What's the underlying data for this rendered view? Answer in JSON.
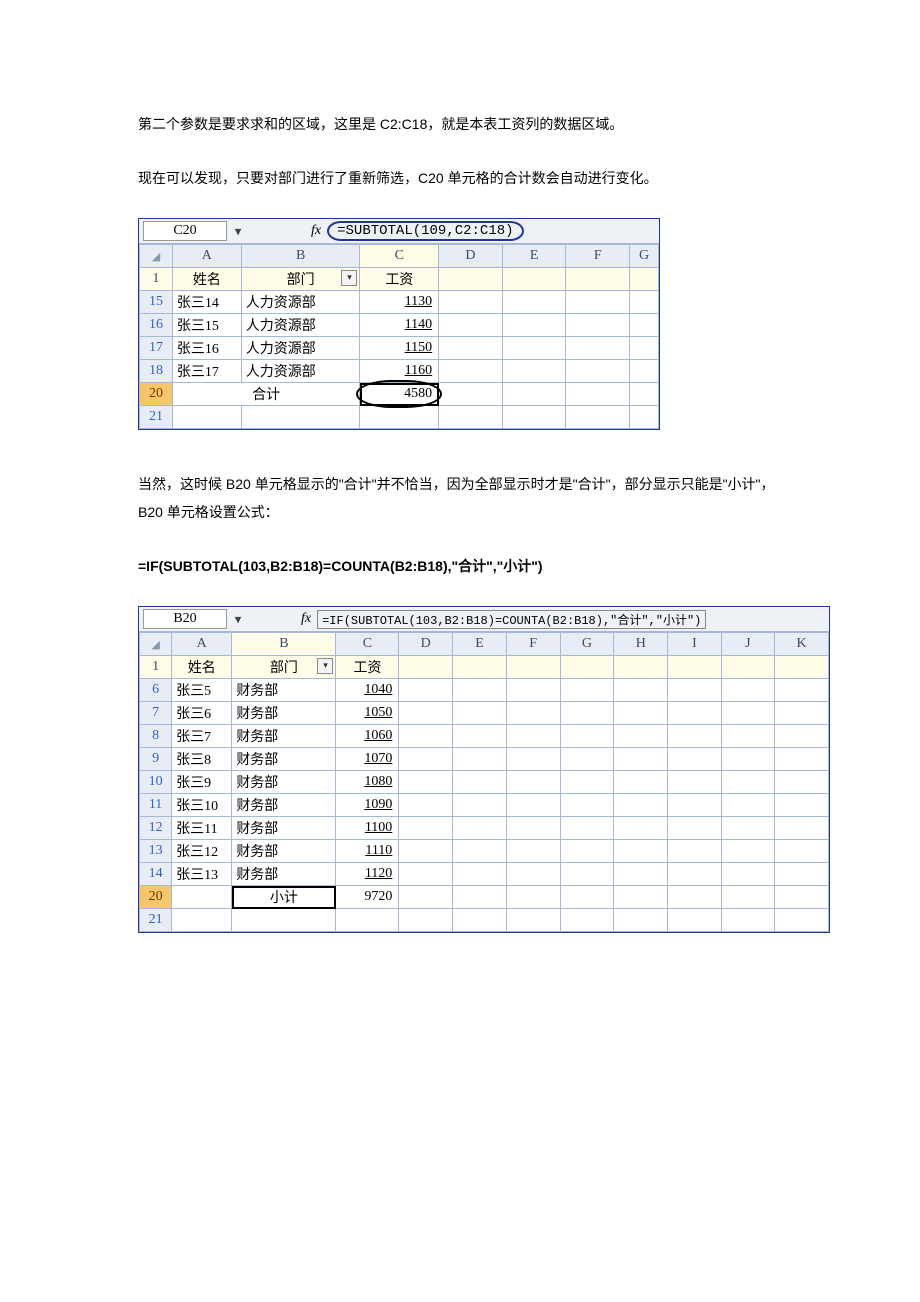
{
  "text": {
    "p1": "第二个参数是要求求和的区域，这里是 C2:C18，就是本表工资列的数据区域。",
    "p2": "现在可以发现，只要对部门进行了重新筛选，C20 单元格的合计数会自动进行变化。",
    "p3": "当然，这时候 B20 单元格显示的\"合计\"并不恰当，因为全部显示时才是\"合计\"，部分显示只能是\"小计\"，B20 单元格设置公式：",
    "formula_inline": "=IF(SUBTOTAL(103,B2:B18)=COUNTA(B2:B18),\"合计\",\"小计\")"
  },
  "sheet1": {
    "active_cell": "C20",
    "formula": "=SUBTOTAL(109,C2:C18)",
    "fx_label": "fx",
    "cols": [
      "A",
      "B",
      "C",
      "D",
      "E",
      "F",
      "G"
    ],
    "header": {
      "A": "姓名",
      "B": "部门",
      "C": "工资"
    },
    "rows": [
      {
        "n": "15",
        "a": "张三14",
        "b": "人力资源部",
        "c": "1130"
      },
      {
        "n": "16",
        "a": "张三15",
        "b": "人力资源部",
        "c": "1140"
      },
      {
        "n": "17",
        "a": "张三16",
        "b": "人力资源部",
        "c": "1150"
      },
      {
        "n": "18",
        "a": "张三17",
        "b": "人力资源部",
        "c": "1160"
      }
    ],
    "total": {
      "n": "20",
      "label": "合计",
      "value": "4580"
    },
    "blank_row": "21",
    "filter_glyph": "▾"
  },
  "sheet2": {
    "active_cell": "B20",
    "formula": "=IF(SUBTOTAL(103,B2:B18)=COUNTA(B2:B18),\"合计\",\"小计\")",
    "fx_label": "fx",
    "cols": [
      "A",
      "B",
      "C",
      "D",
      "E",
      "F",
      "G",
      "H",
      "I",
      "J",
      "K"
    ],
    "header": {
      "A": "姓名",
      "B": "部门",
      "C": "工资"
    },
    "rows": [
      {
        "n": "6",
        "a": "张三5",
        "b": "财务部",
        "c": "1040"
      },
      {
        "n": "7",
        "a": "张三6",
        "b": "财务部",
        "c": "1050"
      },
      {
        "n": "8",
        "a": "张三7",
        "b": "财务部",
        "c": "1060"
      },
      {
        "n": "9",
        "a": "张三8",
        "b": "财务部",
        "c": "1070"
      },
      {
        "n": "10",
        "a": "张三9",
        "b": "财务部",
        "c": "1080"
      },
      {
        "n": "11",
        "a": "张三10",
        "b": "财务部",
        "c": "1090"
      },
      {
        "n": "12",
        "a": "张三11",
        "b": "财务部",
        "c": "1100"
      },
      {
        "n": "13",
        "a": "张三12",
        "b": "财务部",
        "c": "1110"
      },
      {
        "n": "14",
        "a": "张三13",
        "b": "财务部",
        "c": "1120"
      }
    ],
    "total": {
      "n": "20",
      "label": "小计",
      "value": "9720"
    },
    "blank_row": "21",
    "filter_glyph": "▾"
  }
}
